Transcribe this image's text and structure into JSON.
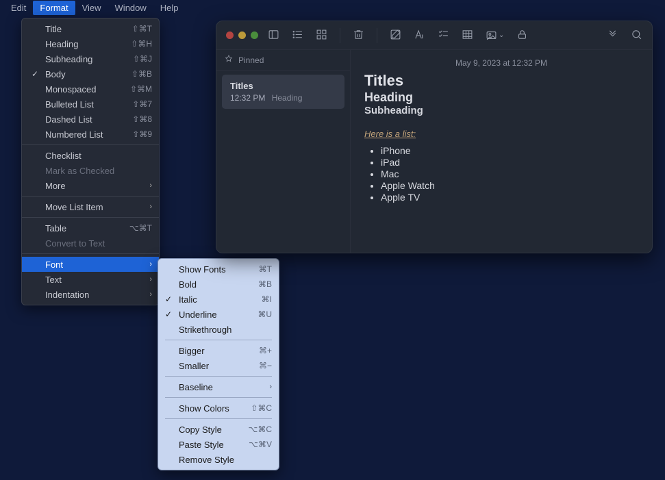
{
  "menubar": {
    "items": [
      "Edit",
      "Format",
      "View",
      "Window",
      "Help"
    ],
    "active": "Format"
  },
  "format_menu": {
    "groups": [
      [
        {
          "label": "Title",
          "shortcut": "⇧⌘T"
        },
        {
          "label": "Heading",
          "shortcut": "⇧⌘H"
        },
        {
          "label": "Subheading",
          "shortcut": "⇧⌘J"
        },
        {
          "label": "Body",
          "shortcut": "⇧⌘B",
          "checked": true
        },
        {
          "label": "Monospaced",
          "shortcut": "⇧⌘M"
        },
        {
          "label": "Bulleted List",
          "shortcut": "⇧⌘7"
        },
        {
          "label": "Dashed List",
          "shortcut": "⇧⌘8"
        },
        {
          "label": "Numbered List",
          "shortcut": "⇧⌘9"
        }
      ],
      [
        {
          "label": "Checklist",
          "shortcut": ""
        },
        {
          "label": "Mark as Checked",
          "shortcut": "",
          "disabled": true
        },
        {
          "label": "More",
          "submenu": true
        }
      ],
      [
        {
          "label": "Move List Item",
          "submenu": true
        }
      ],
      [
        {
          "label": "Table",
          "shortcut": "⌥⌘T"
        },
        {
          "label": "Convert to Text",
          "shortcut": "",
          "disabled": true
        }
      ],
      [
        {
          "label": "Font",
          "submenu": true,
          "highlight": true
        },
        {
          "label": "Text",
          "submenu": true
        },
        {
          "label": "Indentation",
          "submenu": true
        }
      ]
    ]
  },
  "font_submenu": {
    "groups": [
      [
        {
          "label": "Show Fonts",
          "shortcut": "⌘T"
        },
        {
          "label": "Bold",
          "shortcut": "⌘B"
        },
        {
          "label": "Italic",
          "shortcut": "⌘I",
          "checked": true
        },
        {
          "label": "Underline",
          "shortcut": "⌘U",
          "checked": true
        },
        {
          "label": "Strikethrough",
          "shortcut": ""
        }
      ],
      [
        {
          "label": "Bigger",
          "shortcut": "⌘+"
        },
        {
          "label": "Smaller",
          "shortcut": "⌘−"
        }
      ],
      [
        {
          "label": "Baseline",
          "submenu": true
        }
      ],
      [
        {
          "label": "Show Colors",
          "shortcut": "⇧⌘C"
        }
      ],
      [
        {
          "label": "Copy Style",
          "shortcut": "⌥⌘C"
        },
        {
          "label": "Paste Style",
          "shortcut": "⌥⌘V"
        },
        {
          "label": "Remove Style",
          "shortcut": ""
        }
      ]
    ]
  },
  "window": {
    "pinned_label": "Pinned",
    "note_card": {
      "title": "Titles",
      "time": "12:32 PM",
      "preview": "Heading"
    },
    "date_line": "May 9, 2023 at 12:32 PM",
    "h1": "Titles",
    "h2": "Heading",
    "h3": "Subheading",
    "list_lead": "Here is a list:",
    "items": [
      "iPhone",
      "iPad",
      "Mac",
      "Apple Watch",
      "Apple TV"
    ]
  }
}
